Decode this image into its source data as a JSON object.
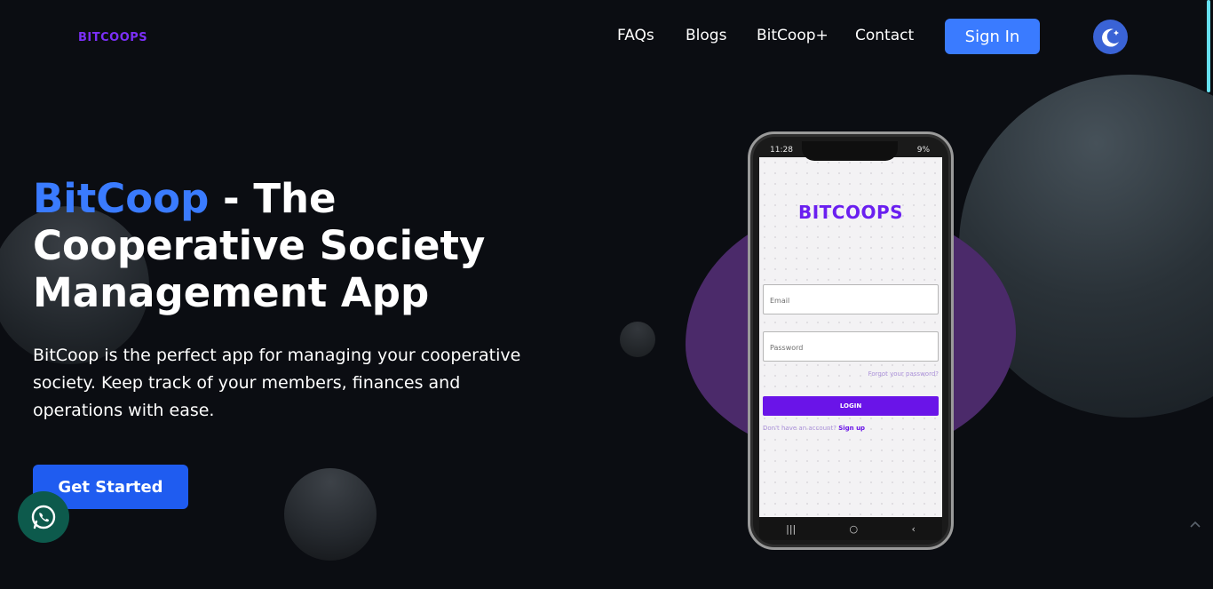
{
  "header": {
    "logo_text": "BITCOOPS",
    "nav": [
      "FAQs",
      "Blogs",
      "BitCoop+",
      "Contact"
    ],
    "signin_label": "Sign In"
  },
  "hero": {
    "title_accent": "BitCoop",
    "title_rest": " - The Cooperative Society Management App",
    "description": "BitCoop is the perfect app for managing your cooperative society. Keep track of your members, finances and operations with ease.",
    "cta_label": "Get Started"
  },
  "phone": {
    "status_time": "11:28",
    "status_battery": "9%",
    "logo_text": "BITCOOPS",
    "email_placeholder": "Email",
    "password_placeholder": "Password",
    "forgot_label": "Forgot your password?",
    "login_label": "LOGIN",
    "signup_prompt": "Don't have an account?",
    "signup_link": "Sign up"
  },
  "colors": {
    "accent_blue": "#3a7bff",
    "brand_purple": "#6a14e8",
    "background": "#0b0d12",
    "whatsapp_green": "#0d5a4c"
  },
  "icons": {
    "theme_toggle": "moon-icon",
    "whatsapp": "whatsapp-icon",
    "scroll_top": "chevron-up-icon"
  }
}
